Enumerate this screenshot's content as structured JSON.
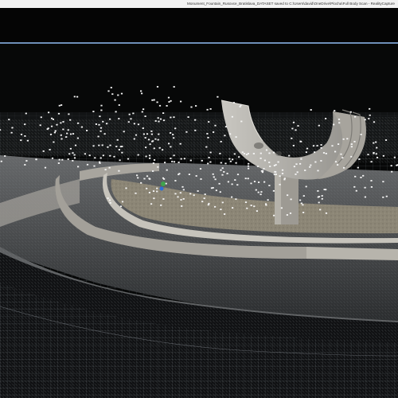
{
  "window": {
    "title": "Monument_Fountain_Rusovce_Bratislava_DATASET saved to C:\\Users\\david\\OneDrive\\Plocha\\Full Body Scan - RealityCapture"
  },
  "viewport": {
    "view": "3D",
    "background": "#070808",
    "grid_color": "#8a8f96",
    "point_color": "#f4f4f4",
    "camera_marker_color": "#3fa34d"
  },
  "colors": {
    "title_bar": "#f2f2f2",
    "toolbar": "#050505",
    "accent_line": "#6e8fb8"
  }
}
